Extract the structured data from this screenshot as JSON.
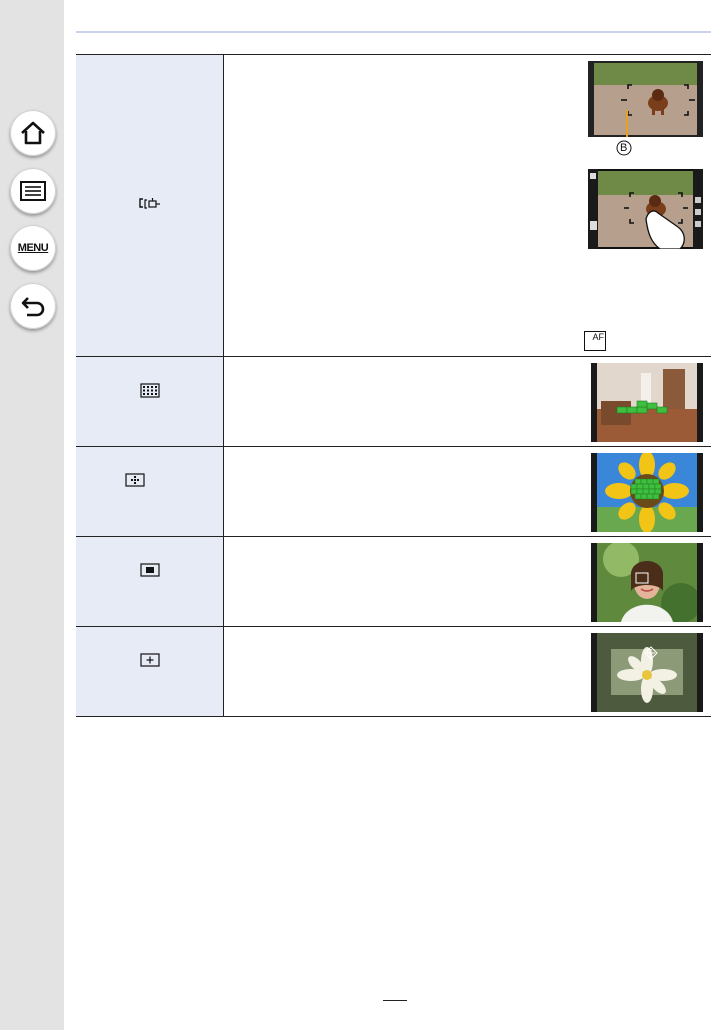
{
  "sidebar": {
    "items": [
      {
        "name": "home-icon"
      },
      {
        "name": "contents-icon"
      },
      {
        "name": "menu-icon",
        "label": "MENU"
      },
      {
        "name": "back-icon"
      }
    ]
  },
  "table": {
    "rows": [
      {
        "mode_icon": "tracking-af-icon",
        "callout": "B",
        "af_off_icon": "AF"
      },
      {
        "mode_icon": "49-area-icon"
      },
      {
        "mode_icon": "custom-multi-icon"
      },
      {
        "mode_icon": "1-area-icon"
      },
      {
        "mode_icon": "pinpoint-icon"
      }
    ]
  },
  "colors": {
    "sidebar": "#e3e3e3",
    "mode_column": "#e6ebf6",
    "rule": "#c9d3ea",
    "af_frame": "#3fbf3f"
  }
}
